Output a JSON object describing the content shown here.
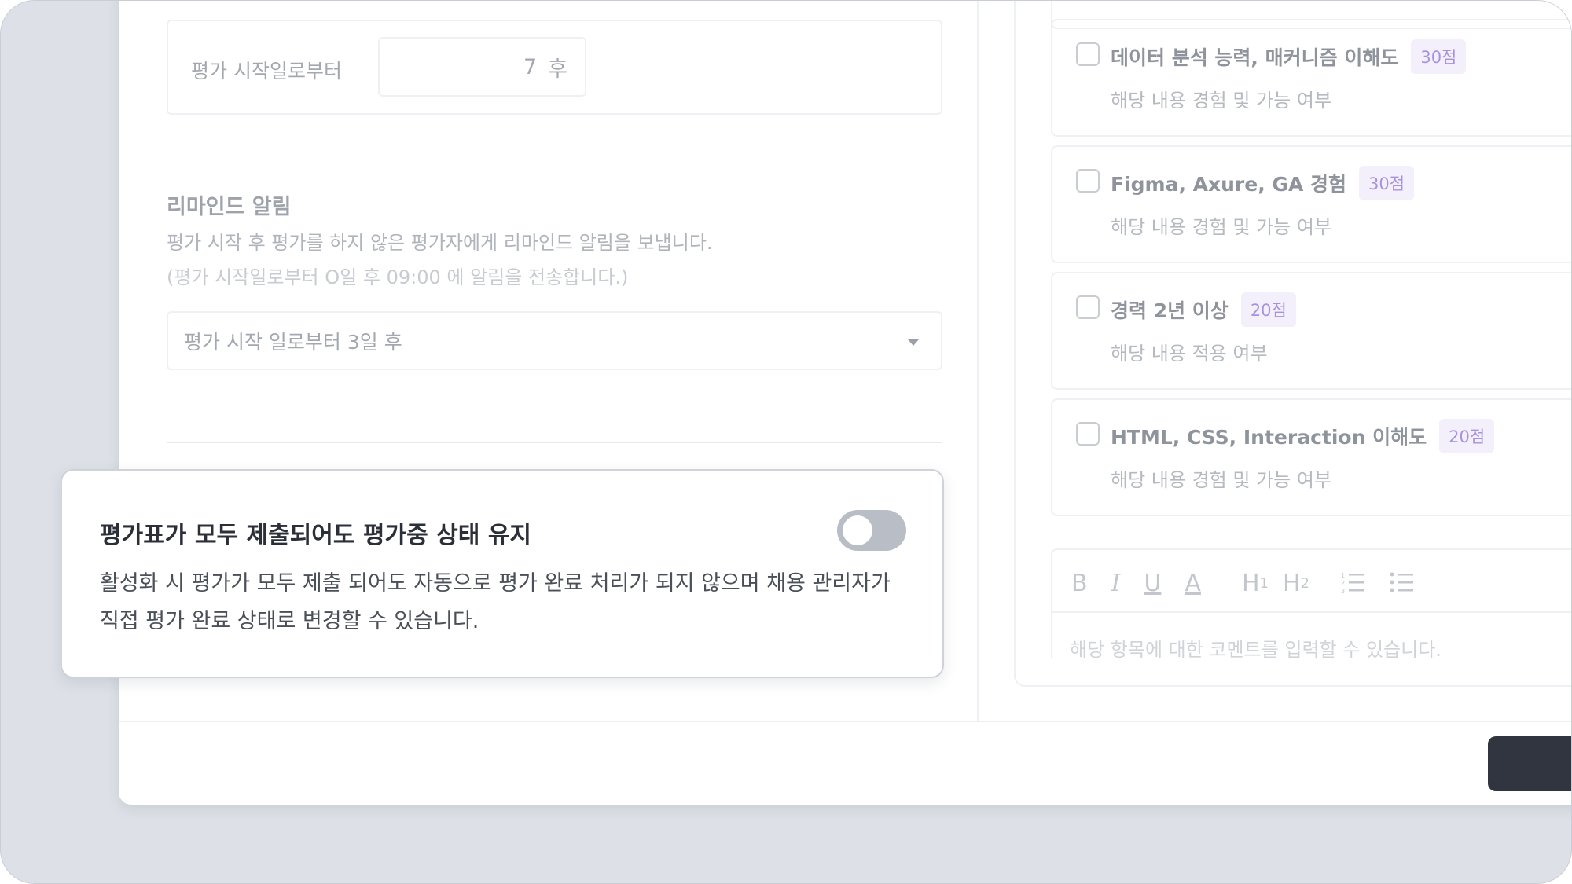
{
  "start_section": {
    "label": "평가 시작일로부터",
    "value": "7",
    "unit": "후"
  },
  "reminder": {
    "title": "리마인드 알림",
    "description": "평가 시작 후 평가를 하지 않은 평가자에게 리마인드 알림을 보냅니다.",
    "note": "(평가 시작일로부터 O일 후 09:00 에 알림을 전송합니다.)",
    "selected_option": "평가 시작 일로부터 3일 후"
  },
  "criteria": [
    {
      "title": "데이터 분석 능력, 매커니즘 이해도",
      "points": "30점",
      "description": "해당 내용 경험 및 가능 여부"
    },
    {
      "title": "Figma, Axure, GA 경험",
      "points": "30점",
      "description": "해당 내용 경험 및 가능 여부"
    },
    {
      "title": "경력 2년 이상",
      "points": "20점",
      "description": "해당 내용 적용 여부"
    },
    {
      "title": "HTML, CSS, Interaction 이해도",
      "points": "20점",
      "description": "해당 내용 경험 및 가능 여부"
    }
  ],
  "editor": {
    "toolbar": {
      "bold": "B",
      "italic": "I",
      "underline": "U",
      "text_color": "A",
      "h1": "H",
      "h1_sub": "1",
      "h2": "H",
      "h2_sub": "2"
    },
    "placeholder": "해당 항목에 대한 코멘트를 입력할 수 있습니다."
  },
  "overlay": {
    "title": "평가표가 모두 제출되어도 평가중 상태 유지",
    "description": "활성화 시 평가가 모두 제출 되어도 자동으로 평가 완료 처리가 되지 않으며 채용 관리자가 직접 평가 완료 상태로 변경할 수 있습니다.",
    "toggle_on": false
  },
  "colors": {
    "badge_text": "#a892e0",
    "badge_bg": "#f3f0fc",
    "primary_button": "#303540",
    "toggle_off": "#b9bdc5"
  }
}
